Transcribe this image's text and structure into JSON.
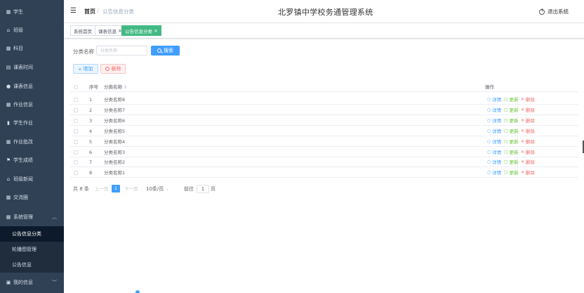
{
  "header": {
    "breadcrumb_home": "首页",
    "breadcrumb_sep": "/",
    "breadcrumb_current": "公告信息分类",
    "system_title": "北罗镇中学校务通管理系统",
    "logout": "退出系统"
  },
  "sidebar": {
    "items": [
      {
        "label": "学生",
        "icon": "grid-icon"
      },
      {
        "label": "班级",
        "icon": "bank-icon"
      },
      {
        "label": "科目",
        "icon": "grid-icon"
      },
      {
        "label": "课表时间",
        "icon": "calendar-icon"
      },
      {
        "label": "课表信息",
        "icon": "user-icon"
      },
      {
        "label": "作业信息",
        "icon": "grid-icon"
      },
      {
        "label": "学生作业",
        "icon": "chart-icon"
      },
      {
        "label": "作业批改",
        "icon": "grid-icon"
      },
      {
        "label": "学生成绩",
        "icon": "flag-icon"
      },
      {
        "label": "班级新闻",
        "icon": "bank-icon"
      },
      {
        "label": "交流圈",
        "icon": "grid-icon"
      },
      {
        "label": "系统管理",
        "icon": "grid-icon"
      }
    ],
    "sub_items": [
      {
        "label": "公告信息分类",
        "active": true
      },
      {
        "label": "轮播图管理",
        "active": false
      },
      {
        "label": "公告信息",
        "active": false
      }
    ],
    "bottom_item": {
      "label": "我的信息",
      "icon": "profile-icon"
    }
  },
  "tabs": [
    {
      "label": "系统首页",
      "closable": false,
      "active": false
    },
    {
      "label": "课表信息",
      "closable": true,
      "active": false
    },
    {
      "label": "公告信息分类",
      "closable": true,
      "active": true
    }
  ],
  "search": {
    "label": "分类名称",
    "placeholder": "分类名称",
    "button": "搜索"
  },
  "actions": {
    "add": "增加",
    "delete": "删除"
  },
  "table": {
    "headers": {
      "index": "序号",
      "name": "分类名称",
      "ops": "操作"
    },
    "rows": [
      {
        "index": "1",
        "name": "分类名称8"
      },
      {
        "index": "2",
        "name": "分类名称7"
      },
      {
        "index": "3",
        "name": "分类名称6"
      },
      {
        "index": "4",
        "name": "分类名称5"
      },
      {
        "index": "5",
        "name": "分类名称4"
      },
      {
        "index": "6",
        "name": "分类名称3"
      },
      {
        "index": "7",
        "name": "分类名称2"
      },
      {
        "index": "8",
        "name": "分类名称1"
      }
    ],
    "op_labels": {
      "detail": "详情",
      "edit": "更新",
      "delete": "删除"
    }
  },
  "pagination": {
    "total": "共 8 条",
    "prev": "上一页",
    "current": "1",
    "next": "下一页",
    "page_size": "10条/页",
    "goto_label": "前往",
    "goto_value": "1",
    "goto_suffix": "页"
  },
  "colors": {
    "sidebar_bg": "#304156",
    "primary": "#409eff",
    "tab_active": "#42b983",
    "danger": "#f56c6c",
    "success": "#67c23a"
  }
}
